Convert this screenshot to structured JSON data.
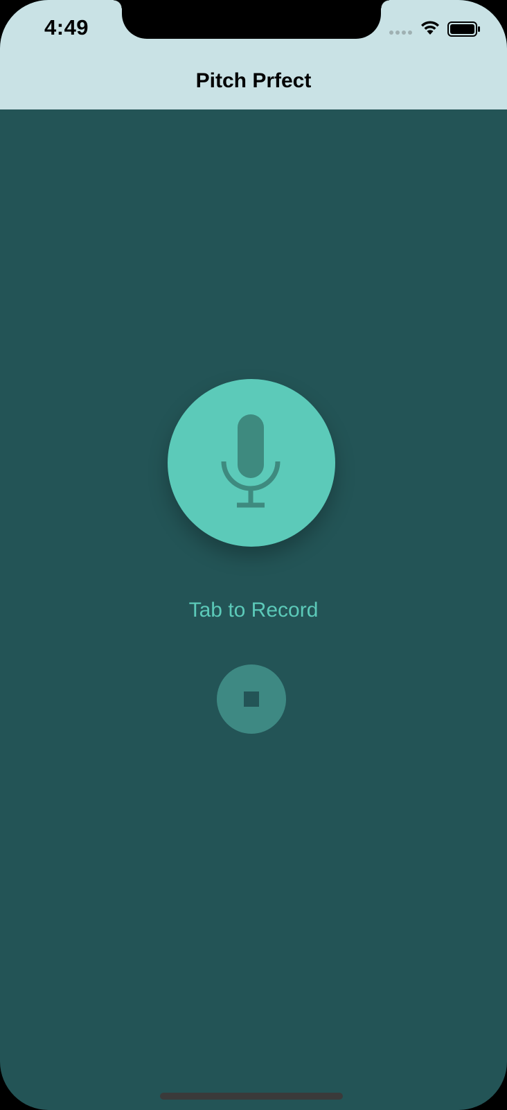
{
  "status_bar": {
    "time": "4:49"
  },
  "nav": {
    "title": "Pitch Prfect"
  },
  "main": {
    "record_label": "Tab to Record",
    "record_icon": "microphone-icon",
    "stop_icon": "stop-icon"
  },
  "colors": {
    "background": "#235456",
    "accent": "#5ccab9",
    "nav_bar": "#c9e2e5",
    "stop_button": "#3e8983"
  }
}
